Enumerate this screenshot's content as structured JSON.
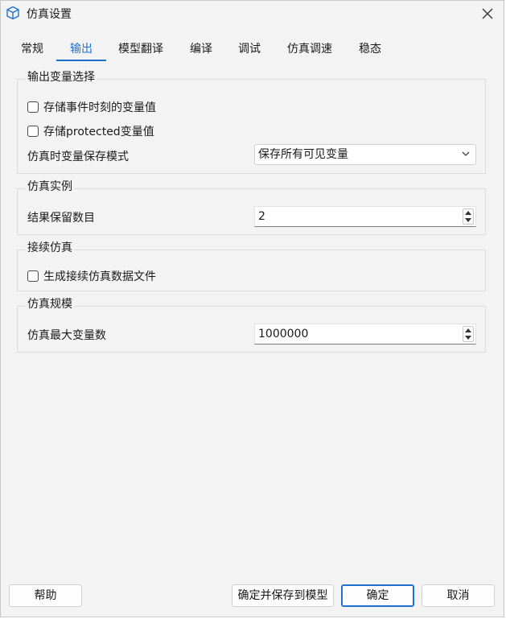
{
  "window": {
    "title": "仿真设置"
  },
  "tabs": [
    {
      "label": "常规",
      "active": false
    },
    {
      "label": "输出",
      "active": true
    },
    {
      "label": "模型翻译",
      "active": false
    },
    {
      "label": "编译",
      "active": false
    },
    {
      "label": "调试",
      "active": false
    },
    {
      "label": "仿真调速",
      "active": false
    },
    {
      "label": "稳态",
      "active": false
    }
  ],
  "output_var_group": {
    "title": "输出变量选择",
    "store_event_vars": {
      "label": "存储事件时刻的变量值",
      "checked": false
    },
    "store_protected_vars": {
      "label": "存储protected变量值",
      "checked": false
    },
    "save_mode_label": "仿真时变量保存模式",
    "save_mode_value": "保存所有可见变量"
  },
  "instance_group": {
    "title": "仿真实例",
    "result_keep_label": "结果保留数目",
    "result_keep_value": "2"
  },
  "continue_group": {
    "title": "接续仿真",
    "gen_file": {
      "label": "生成接续仿真数据文件",
      "checked": false
    }
  },
  "scale_group": {
    "title": "仿真规模",
    "max_vars_label": "仿真最大变量数",
    "max_vars_value": "1000000"
  },
  "buttons": {
    "help": "帮助",
    "save_to_model": "确定并保存到模型",
    "ok": "确定",
    "cancel": "取消"
  },
  "colors": {
    "accent": "#1f6fd0",
    "background": "#f3f3f3",
    "border": "#dcdcdc"
  },
  "icons": {
    "app": "cube-icon",
    "close": "close-icon",
    "dropdown": "chevron-down-icon",
    "spin_up": "caret-up-icon",
    "spin_down": "caret-down-icon"
  }
}
